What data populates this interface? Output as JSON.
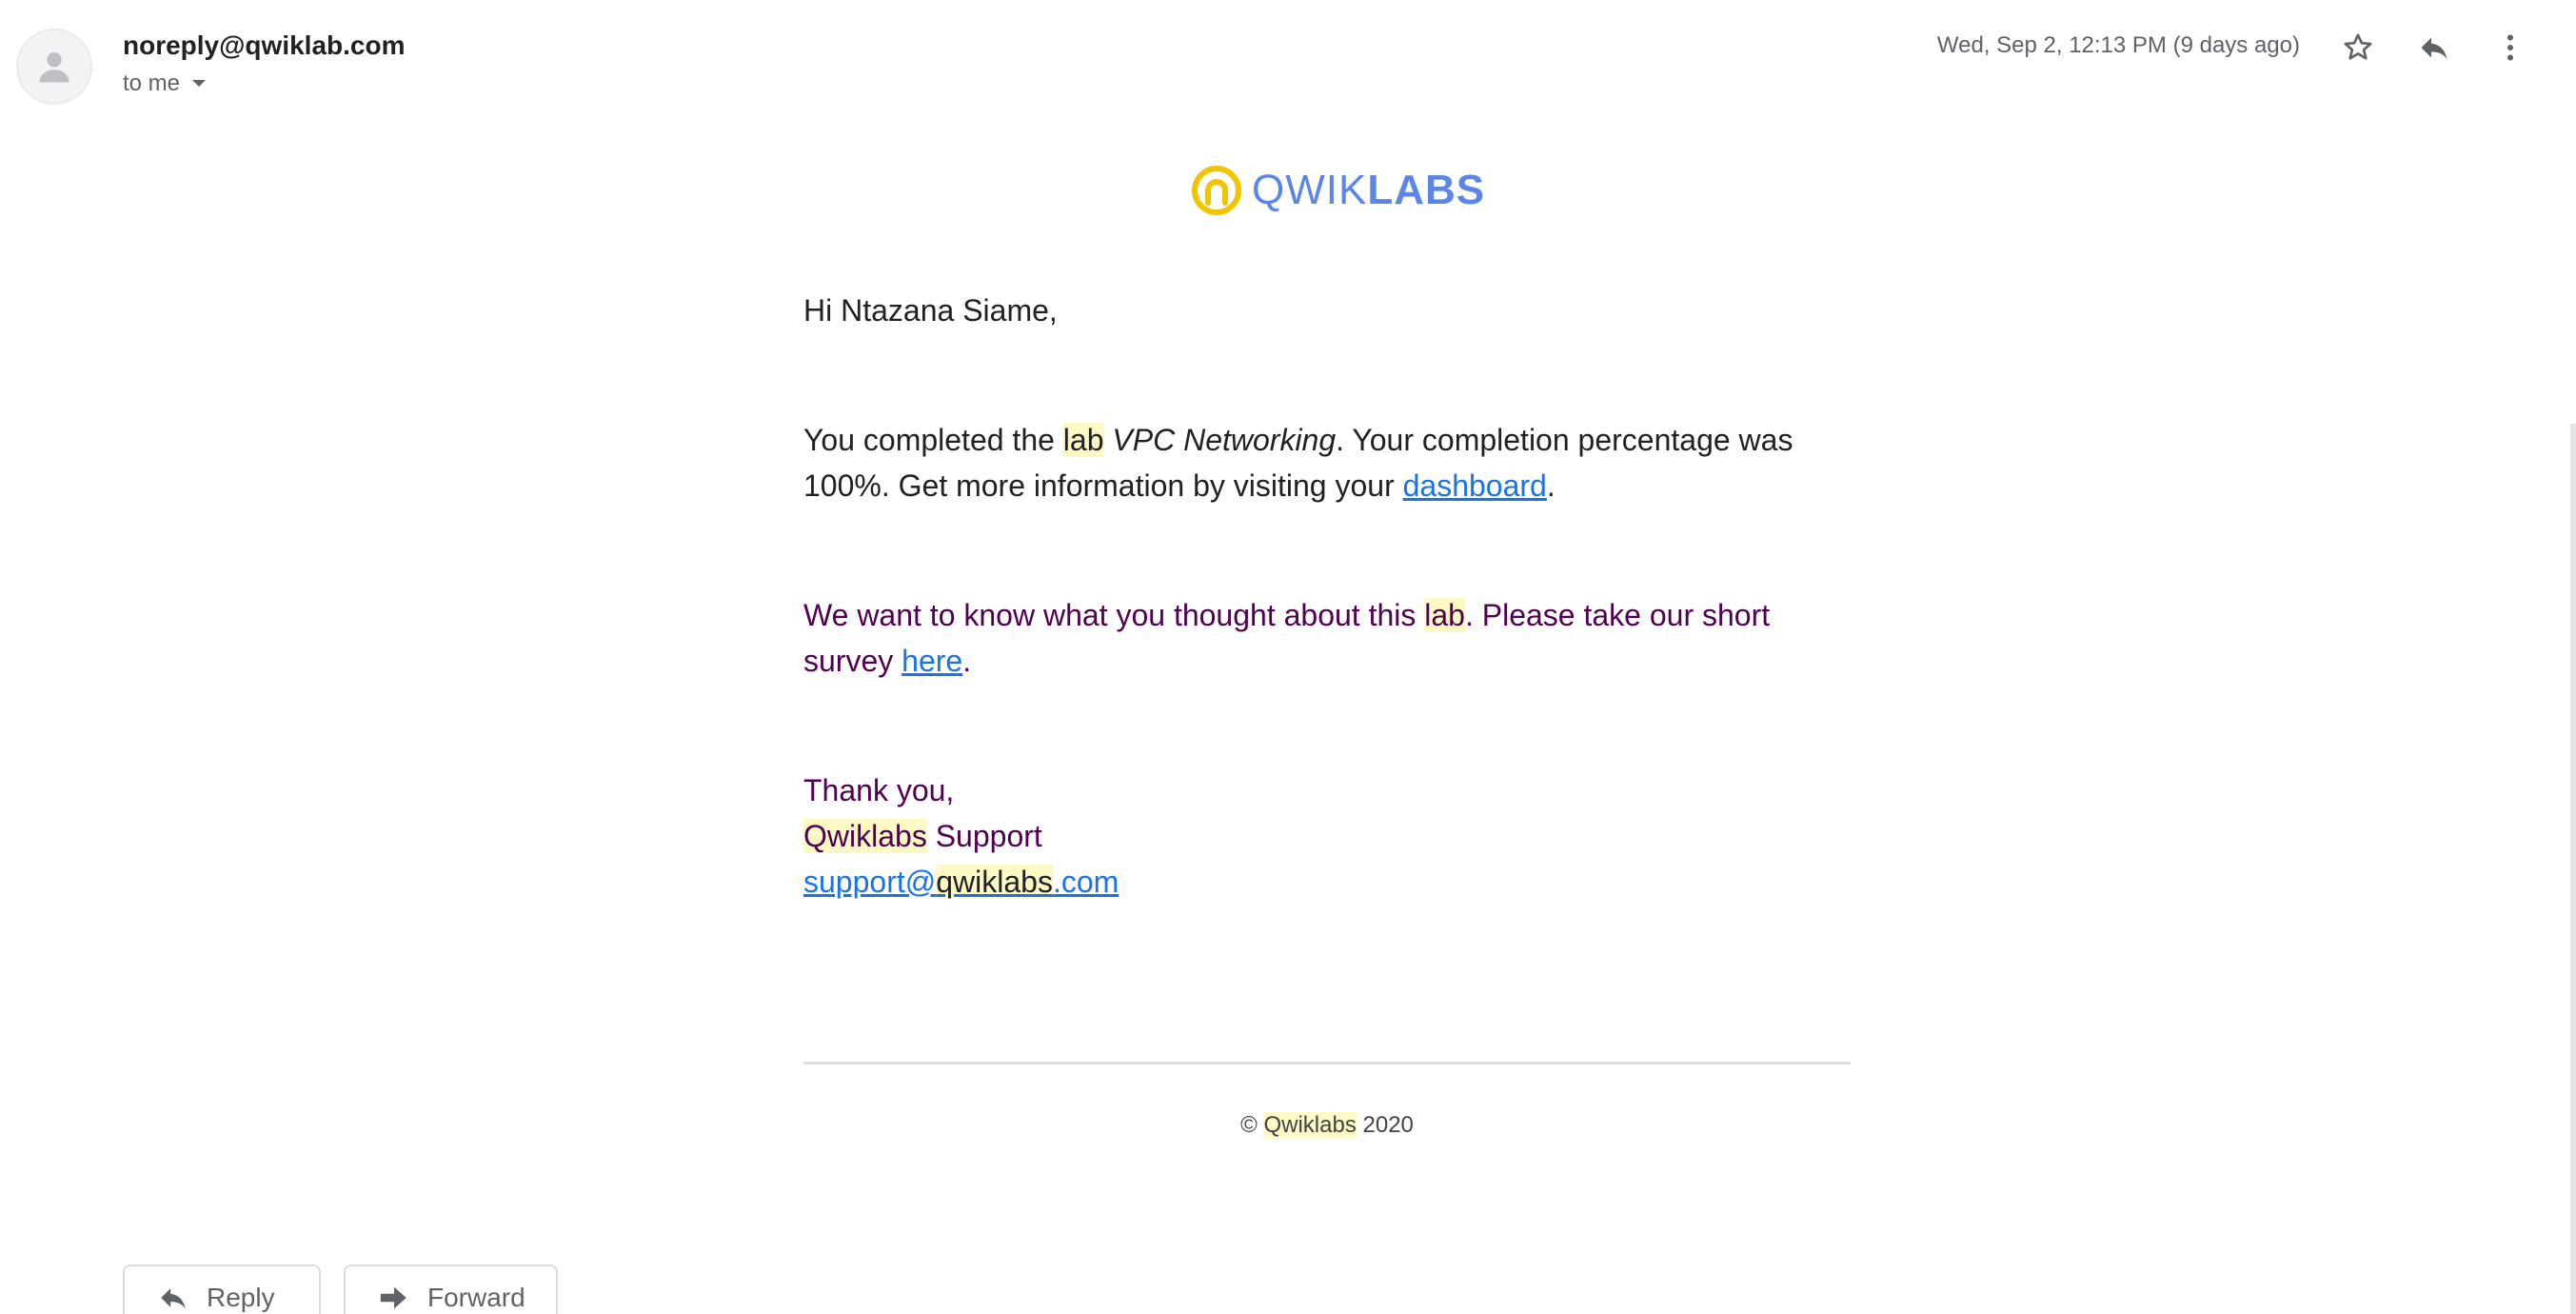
{
  "header": {
    "sender": "noreply@qwiklab.com",
    "recipient_label": "to me",
    "date": "Wed, Sep 2, 12:13 PM (9 days ago)",
    "icons": {
      "avatar": "person-icon",
      "star": "star-icon",
      "reply": "reply-icon",
      "more": "more-vertical-icon",
      "recipient_dropdown": "caret-down-icon"
    }
  },
  "message": {
    "logo": {
      "text_thin": "QWIK",
      "text_bold": "LABS",
      "icon": "qwiklabs-logo-icon"
    },
    "greeting": "Hi Ntazana Siame,",
    "completed": {
      "prefix": "You completed the ",
      "highlight_lab": "lab",
      "space": " ",
      "lab_name": "VPC Networking",
      "middle": ". Your completion percentage was 100%. Get more information by visiting your ",
      "dashboard_link": "dashboard",
      "suffix": "."
    },
    "survey": {
      "prefix": "We want to know what you thought about this ",
      "highlight_lab": "lab",
      "middle": ". Please take our short survey ",
      "here_link": "here",
      "suffix": "."
    },
    "signoff": {
      "thanks": "Thank you,",
      "org_highlight": "Qwiklabs",
      "org_rest": " Support",
      "email_part1": "support@",
      "email_highlight": "qwiklabs",
      "email_part3": ".com"
    },
    "footer": {
      "copyright_symbol": "©",
      "org_highlight": "Qwiklabs",
      "year": "2020"
    }
  },
  "actions": {
    "reply_label": "Reply",
    "forward_label": "Forward",
    "reply_icon": "reply-icon",
    "forward_icon": "forward-icon"
  },
  "colors": {
    "link": "#1a73e8",
    "highlight": "#fdf9c4",
    "quoted_text": "#500050",
    "logo_blue": "#5b86e5",
    "logo_yellow": "#f2c400"
  }
}
